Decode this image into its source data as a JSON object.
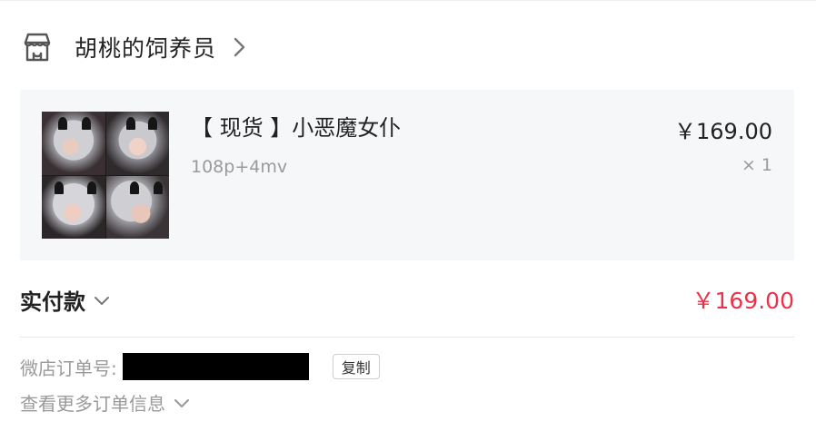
{
  "shop": {
    "name": "胡桃的饲养员",
    "icon": "store-icon",
    "chevron_icon": "chevron-right-icon"
  },
  "product": {
    "title": "【 现货 】小恶魔女仆",
    "spec": "108p+4mv",
    "price": "￥169.00",
    "quantity": "× 1"
  },
  "payment": {
    "label": "实付款",
    "amount": "￥169.00",
    "amount_color": "#e8334a",
    "chevron_icon": "chevron-down-icon"
  },
  "order": {
    "number_label": "微店订单号:",
    "copy_label": "复制",
    "more_label": "查看更多订单信息",
    "more_chevron_icon": "chevron-down-icon"
  }
}
